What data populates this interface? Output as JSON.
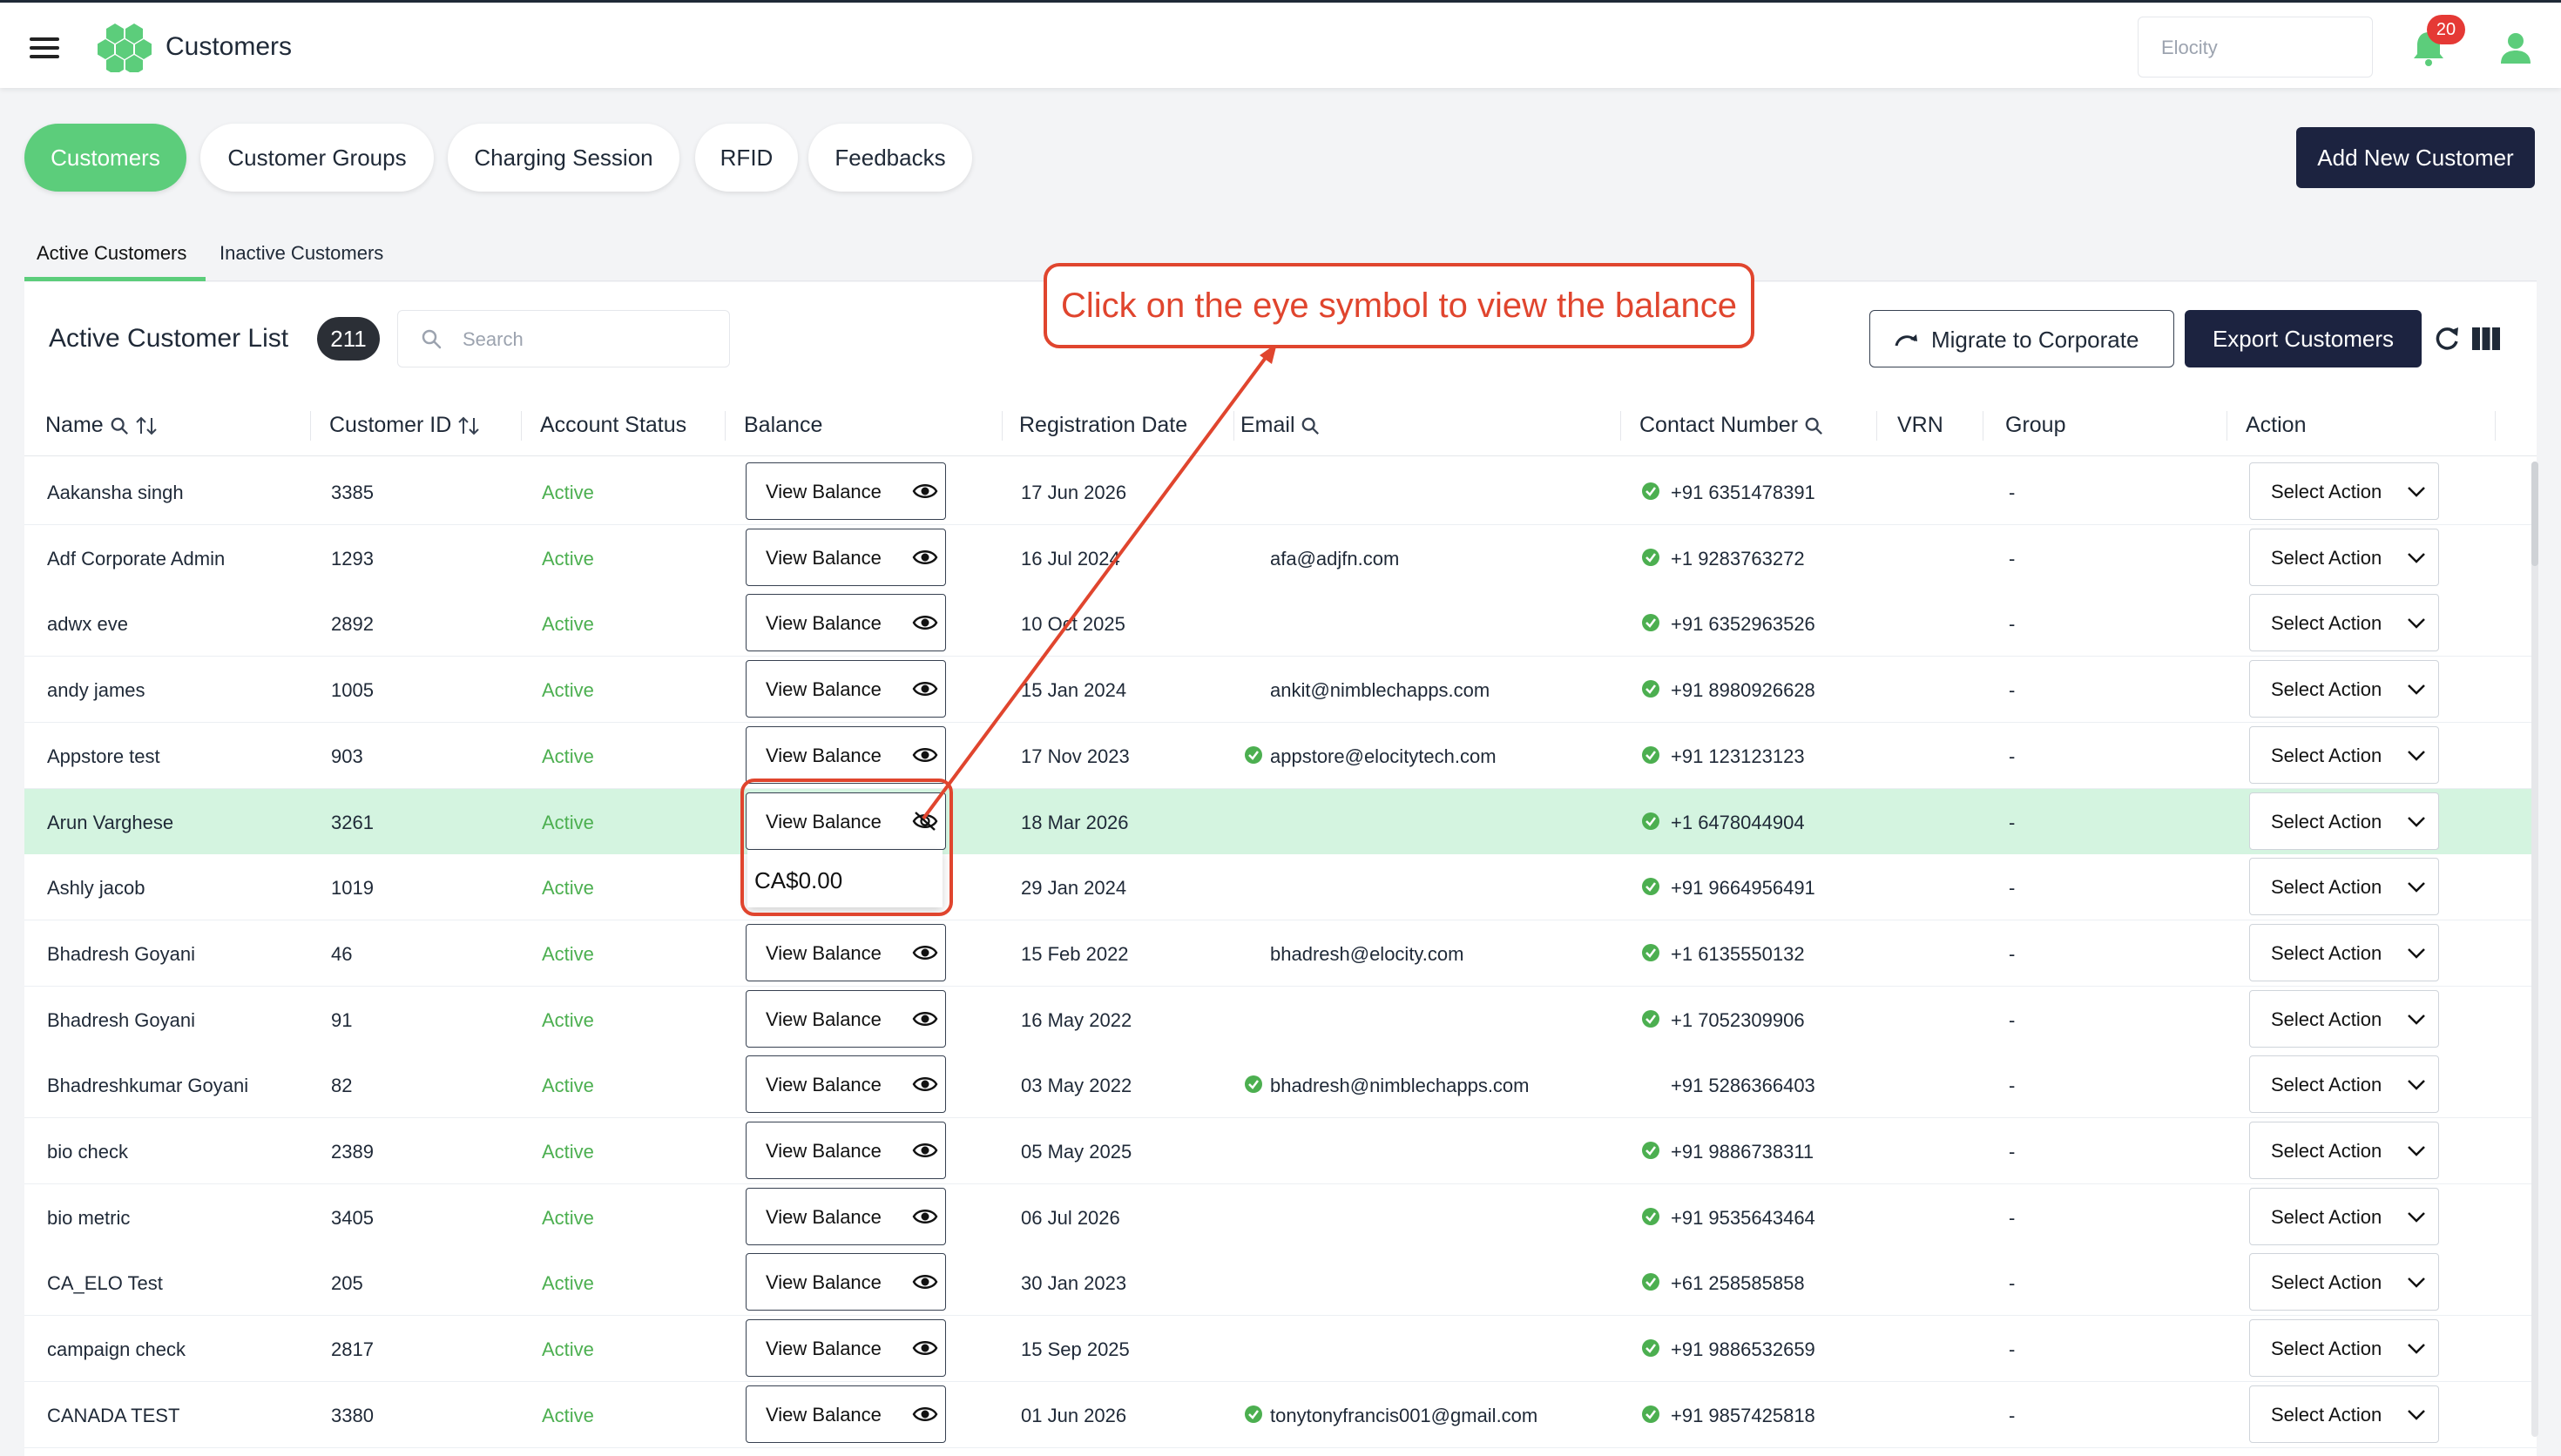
{
  "header": {
    "title": "Customers",
    "org_placeholder": "Elocity",
    "notification_count": "20"
  },
  "tabs": [
    {
      "label": "Customers",
      "active": true
    },
    {
      "label": "Customer Groups"
    },
    {
      "label": "Charging Session"
    },
    {
      "label": "RFID"
    },
    {
      "label": "Feedbacks"
    }
  ],
  "add_button": "Add New Customer",
  "subtabs": [
    {
      "label": "Active Customers",
      "active": true
    },
    {
      "label": "Inactive Customers"
    }
  ],
  "list": {
    "title": "Active Customer List",
    "count": "211",
    "search_placeholder": "Search",
    "migrate_label": "Migrate to Corporate",
    "export_label": "Export Customers"
  },
  "annotation": "Click on the eye symbol to view the balance",
  "columns": [
    "Name",
    "Customer ID",
    "Account Status",
    "Balance",
    "Registration Date",
    "Email",
    "Contact Number",
    "VRN",
    "Group",
    "Action"
  ],
  "view_balance_label": "View Balance",
  "select_action_label": "Select Action",
  "balance_popup_value": "CA$0.00",
  "rows": [
    {
      "name": "Aakansha singh",
      "id": "3385",
      "status": "Active",
      "date": "17 Jun 2026",
      "email": "",
      "email_verified": false,
      "phone": "+91 6351478391",
      "phone_verified": true,
      "group": "-"
    },
    {
      "name": "Adf Corporate Admin",
      "id": "1293",
      "status": "Active",
      "date": "16 Jul 2024",
      "email": "afa@adjfn.com",
      "email_verified": false,
      "phone": "+1 9283763272",
      "phone_verified": true,
      "group": "-"
    },
    {
      "name": "adwx eve",
      "id": "2892",
      "status": "Active",
      "date": "10 Oct 2025",
      "email": "",
      "email_verified": false,
      "phone": "+91 6352963526",
      "phone_verified": true,
      "group": "-"
    },
    {
      "name": "andy james",
      "id": "1005",
      "status": "Active",
      "date": "15 Jan 2024",
      "email": "ankit@nimblechapps.com",
      "email_verified": false,
      "phone": "+91 8980926628",
      "phone_verified": true,
      "group": "-"
    },
    {
      "name": "Appstore test",
      "id": "903",
      "status": "Active",
      "date": "17 Nov 2023",
      "email": "appstore@elocitytech.com",
      "email_verified": true,
      "phone": "+91 123123123",
      "phone_verified": true,
      "group": "-"
    },
    {
      "name": "Arun Varghese",
      "id": "3261",
      "status": "Active",
      "date": "18 Mar 2026",
      "email": "",
      "email_verified": false,
      "phone": "+1 6478044904",
      "phone_verified": true,
      "group": "-",
      "highlight": true
    },
    {
      "name": "Ashly jacob",
      "id": "1019",
      "status": "Active",
      "date": "29 Jan 2024",
      "email": "",
      "email_verified": false,
      "phone": "+91 9664956491",
      "phone_verified": true,
      "group": "-",
      "balance_shown": true
    },
    {
      "name": "Bhadresh Goyani",
      "id": "46",
      "status": "Active",
      "date": "15 Feb 2022",
      "email": "bhadresh@elocity.com",
      "email_verified": false,
      "phone": "+1 6135550132",
      "phone_verified": true,
      "group": "-"
    },
    {
      "name": "Bhadresh Goyani",
      "id": "91",
      "status": "Active",
      "date": "16 May 2022",
      "email": "",
      "email_verified": false,
      "phone": "+1 7052309906",
      "phone_verified": true,
      "group": "-"
    },
    {
      "name": "Bhadreshkumar Goyani",
      "id": "82",
      "status": "Active",
      "date": "03 May 2022",
      "email": "bhadresh@nimblechapps.com",
      "email_verified": true,
      "phone": "+91 5286366403",
      "phone_verified": false,
      "group": "-"
    },
    {
      "name": "bio check",
      "id": "2389",
      "status": "Active",
      "date": "05 May 2025",
      "email": "",
      "email_verified": false,
      "phone": "+91 9886738311",
      "phone_verified": true,
      "group": "-"
    },
    {
      "name": "bio metric",
      "id": "3405",
      "status": "Active",
      "date": "06 Jul 2026",
      "email": "",
      "email_verified": false,
      "phone": "+91 9535643464",
      "phone_verified": true,
      "group": "-"
    },
    {
      "name": "CA_ELO Test",
      "id": "205",
      "status": "Active",
      "date": "30 Jan 2023",
      "email": "",
      "email_verified": false,
      "phone": "+61 258585858",
      "phone_verified": true,
      "group": "-"
    },
    {
      "name": "campaign check",
      "id": "2817",
      "status": "Active",
      "date": "15 Sep 2025",
      "email": "",
      "email_verified": false,
      "phone": "+91 9886532659",
      "phone_verified": true,
      "group": "-"
    },
    {
      "name": "CANADA TEST",
      "id": "3380",
      "status": "Active",
      "date": "01 Jun 2026",
      "email": "tonytonyfrancis001@gmail.com",
      "email_verified": true,
      "phone": "+91 9857425818",
      "phone_verified": true,
      "group": "-"
    }
  ],
  "colors": {
    "brand_green": "#5ccd7b",
    "navy": "#1c2340",
    "annotation_red": "#e0452e",
    "highlight_row": "#d4f4e0"
  },
  "icons": [
    "menu-icon",
    "logo-icon",
    "bell-icon",
    "user-icon",
    "search-icon",
    "sort-icon",
    "eye-icon",
    "eye-off-icon",
    "check-circle-icon",
    "chevron-down-icon",
    "refresh-icon",
    "columns-icon",
    "migrate-icon"
  ]
}
